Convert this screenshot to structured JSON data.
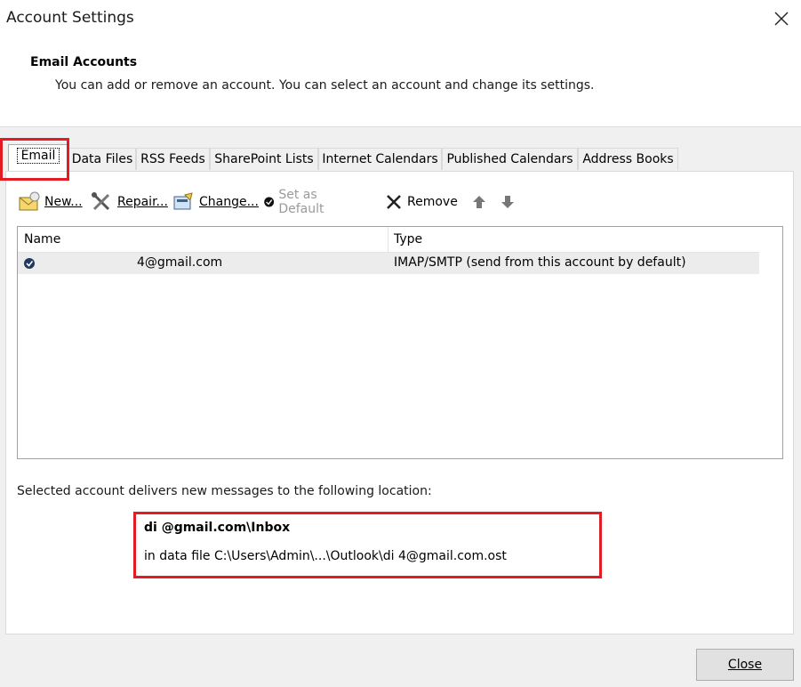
{
  "window": {
    "title": "Account Settings"
  },
  "header": {
    "title": "Email Accounts",
    "subtitle": "You can add or remove an account. You can select an account and change its settings."
  },
  "tabs": [
    {
      "label": "Email",
      "active": true
    },
    {
      "label": "Data Files"
    },
    {
      "label": "RSS Feeds"
    },
    {
      "label": "SharePoint Lists"
    },
    {
      "label": "Internet Calendars"
    },
    {
      "label": "Published Calendars"
    },
    {
      "label": "Address Books"
    }
  ],
  "toolbar": {
    "new_label": "New...",
    "repair_label": "Repair...",
    "change_label": "Change...",
    "set_default_label": "Set as Default",
    "remove_label": "Remove"
  },
  "accounts": {
    "columns": [
      "Name",
      "Type"
    ],
    "rows": [
      {
        "name": "4@gmail.com",
        "type": "IMAP/SMTP (send from this account by default)"
      }
    ]
  },
  "delivery": {
    "label": "Selected account delivers new messages to the following location:",
    "folder": "di @gmail.com\\Inbox",
    "data_file": "in data file C:\\Users\\Admin\\...\\Outlook\\di 4@gmail.com.ost"
  },
  "footer": {
    "close_label": "Close"
  },
  "colors": {
    "highlight_border": "#e31b23",
    "accent_blue": "#1f3864"
  }
}
